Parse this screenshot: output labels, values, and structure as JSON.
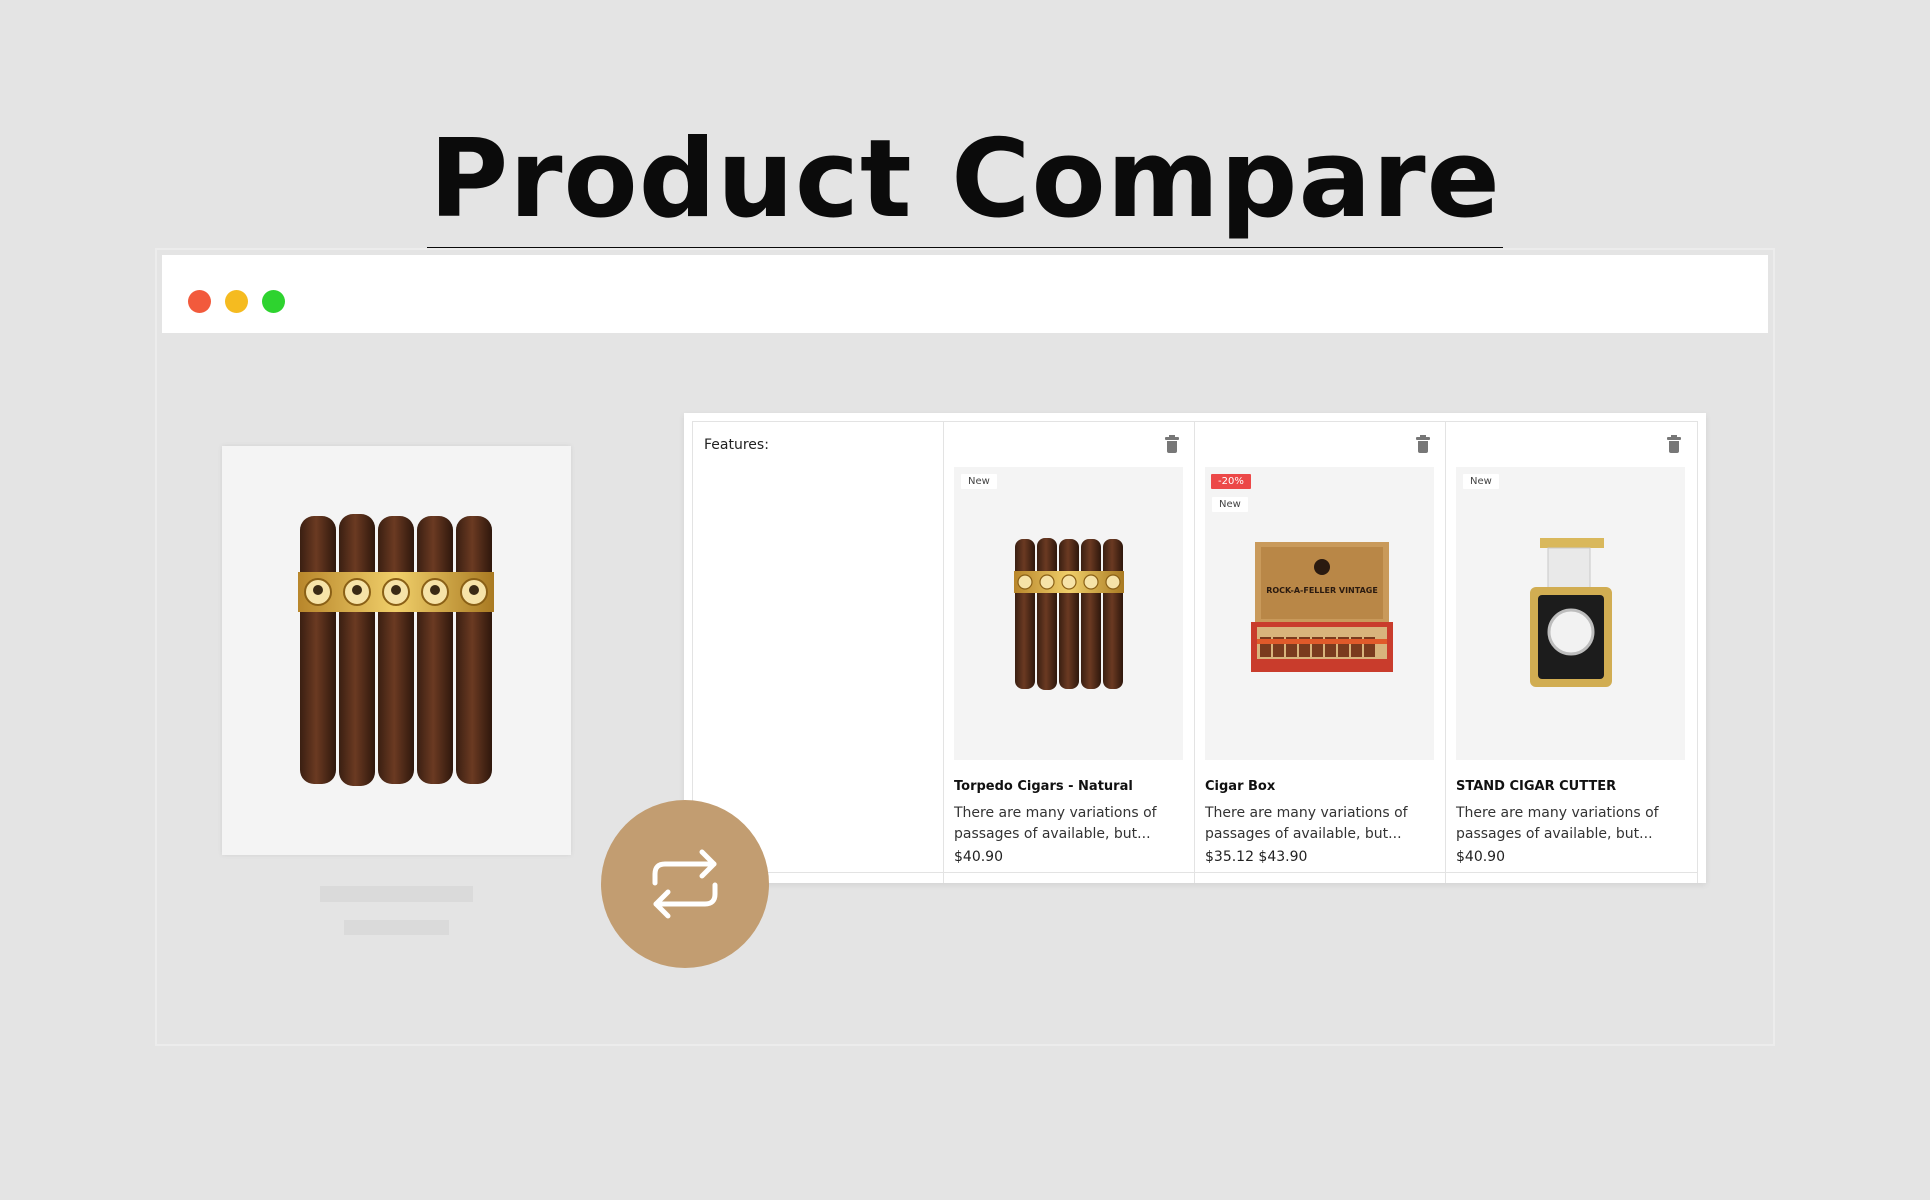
{
  "page": {
    "title": "Product Compare"
  },
  "window": {
    "controls": [
      "close",
      "minimize",
      "maximize"
    ]
  },
  "compare": {
    "features_label": "Features:",
    "products": [
      {
        "name": "Torpedo Cigars - Natural",
        "description": "There are many variations of passages of available, but...",
        "price": "$40.90",
        "badges": [
          "New"
        ],
        "image": "cigar-bundle"
      },
      {
        "name": "Cigar Box",
        "description": "There are many variations of passages of available, but...",
        "price": "$35.12 $43.90",
        "badges": [
          "-20%",
          "New"
        ],
        "image": "cigar-box",
        "box_label": "ROCK-A-FELLER VINTAGE"
      },
      {
        "name": "STAND CIGAR CUTTER",
        "description": "There are many variations of passages of available, but...",
        "price": "$40.90",
        "badges": [
          "New"
        ],
        "image": "cigar-cutter"
      }
    ]
  },
  "colors": {
    "accent": "#c29d71",
    "sale_badge": "#ec4848",
    "background": "#e4e4e4"
  },
  "icons": {
    "remove": "trash-icon",
    "compare": "swap-arrows-icon"
  }
}
